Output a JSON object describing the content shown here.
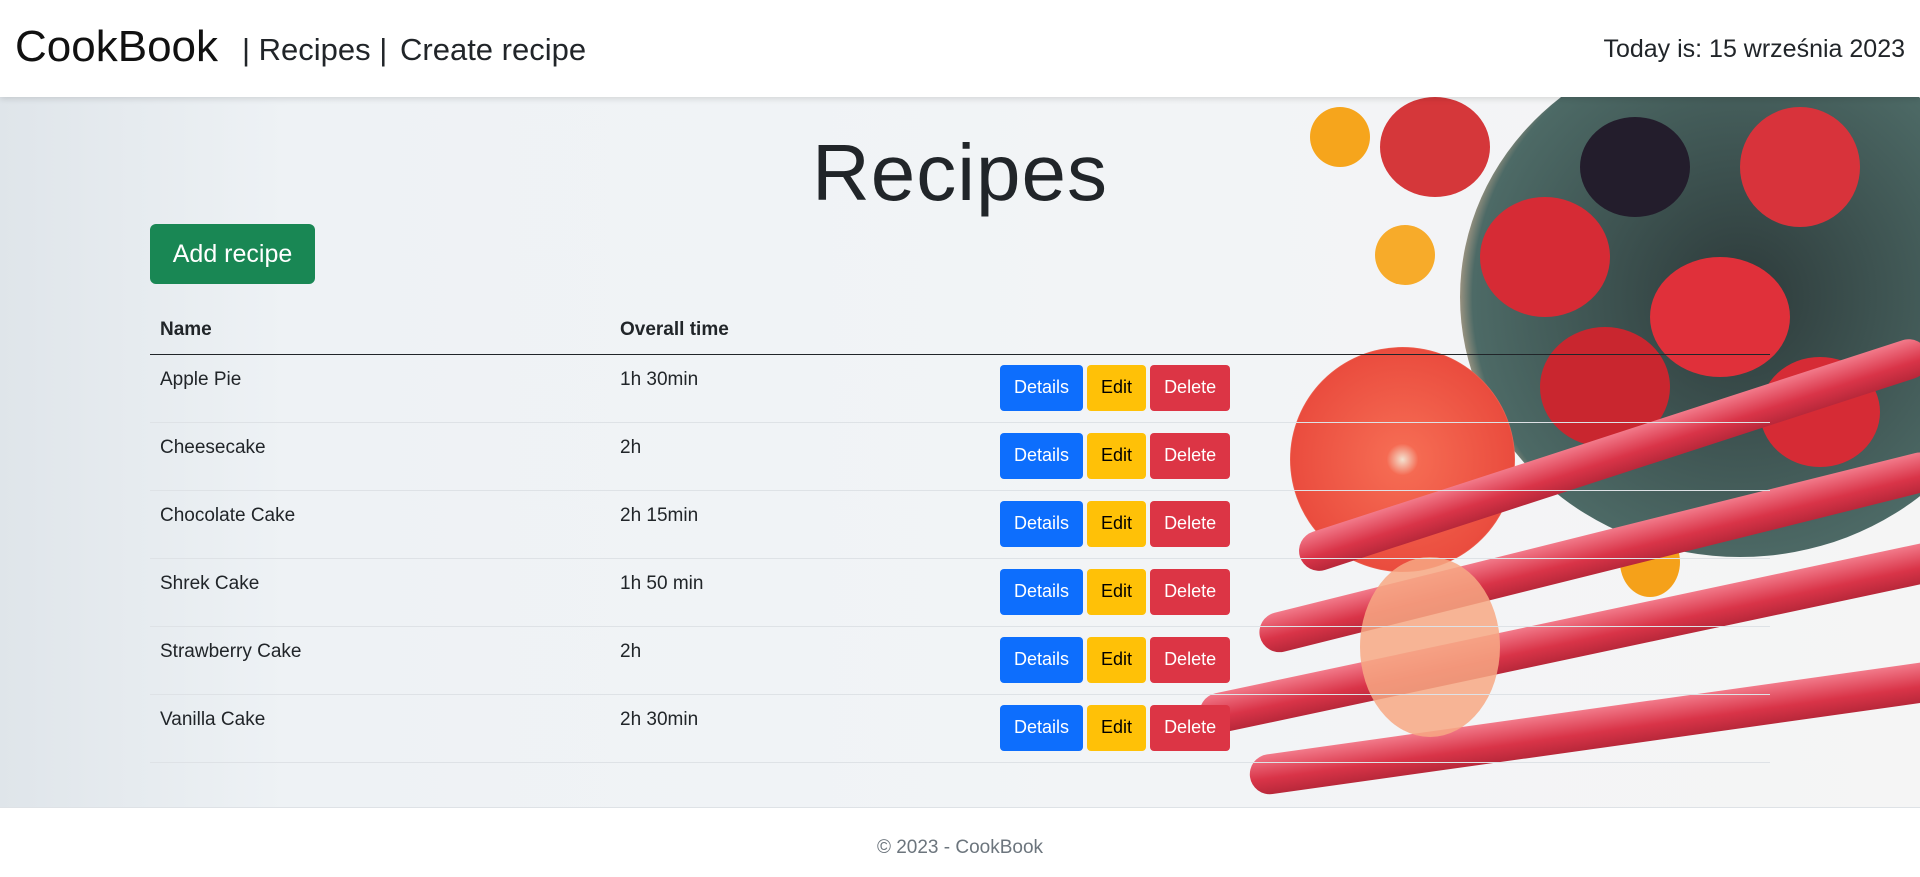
{
  "nav": {
    "brand": "CookBook",
    "links": [
      "| Recipes |",
      "Create recipe"
    ],
    "today": "Today is: 15 września 2023"
  },
  "main": {
    "title": "Recipes",
    "add_button": "Add recipe",
    "columns": [
      "Name",
      "Overall time"
    ],
    "actions": {
      "details": "Details",
      "edit": "Edit",
      "delete": "Delete"
    },
    "rows": [
      {
        "name": "Apple Pie",
        "time": "1h 30min"
      },
      {
        "name": "Cheesecake",
        "time": "2h"
      },
      {
        "name": "Chocolate Cake",
        "time": "2h 15min"
      },
      {
        "name": "Shrek Cake",
        "time": "1h 50 min"
      },
      {
        "name": "Strawberry Cake",
        "time": "2h"
      },
      {
        "name": "Vanilla Cake",
        "time": "2h 30min"
      }
    ]
  },
  "footer": {
    "text": "© 2023 - CookBook"
  },
  "colors": {
    "success": "#198754",
    "primary": "#0d6efd",
    "warning": "#ffc107",
    "danger": "#dc3545"
  }
}
